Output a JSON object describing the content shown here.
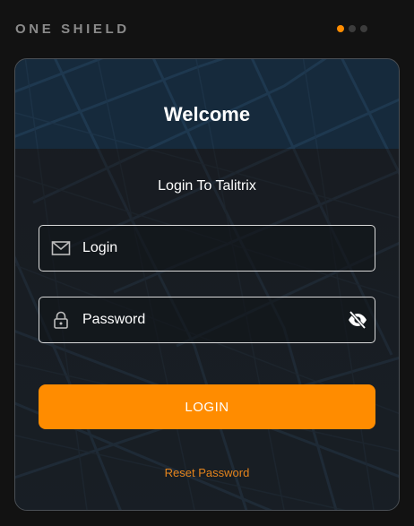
{
  "header": {
    "brand": "ONE SHIELD",
    "pager": {
      "count": 3,
      "active": 1
    }
  },
  "card": {
    "title": "Welcome",
    "subtitle": "Login To Talitrix",
    "login_field": {
      "placeholder": "Login",
      "value": "",
      "icon": "mail-icon"
    },
    "password_field": {
      "placeholder": "Password",
      "value": "",
      "icon": "lock-icon",
      "toggle_icon": "eye-off-icon"
    },
    "login_button": "LOGIN",
    "reset_link": "Reset Password"
  },
  "colors": {
    "accent": "#ff8c00",
    "background": "#121212",
    "link": "#e5841c"
  }
}
